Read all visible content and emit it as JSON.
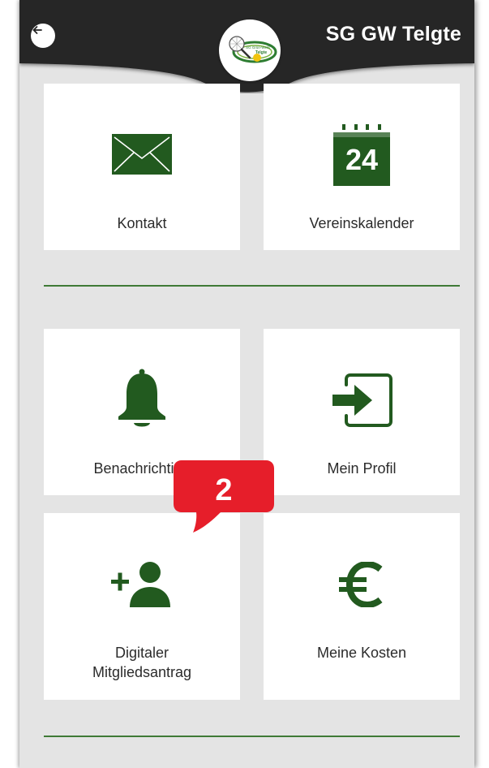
{
  "header": {
    "title": "SG GW Telgte",
    "back_icon": "arrow-left-icon",
    "logo_text_line1": "SG Grün-Weiß",
    "logo_text_line2": "Telgte"
  },
  "tiles": [
    {
      "label": "Kontakt",
      "icon": "envelope-icon"
    },
    {
      "label": "Vereinskalender",
      "icon": "calendar-icon",
      "icon_text": "24"
    },
    {
      "label": "Benachrichtigu",
      "icon": "bell-icon"
    },
    {
      "label": "Mein Profil",
      "icon": "login-arrow-icon"
    },
    {
      "label_line1": "Digitaler",
      "label_line2": "Mitgliedsantrag",
      "icon": "add-person-icon"
    },
    {
      "label": "Meine Kosten",
      "icon": "euro-icon"
    }
  ],
  "callout": {
    "number": "2"
  },
  "colors": {
    "accent_green": "#225a1f",
    "header_dark": "#262626",
    "callout_red": "#e61e2a",
    "background": "#e4e4e4"
  }
}
